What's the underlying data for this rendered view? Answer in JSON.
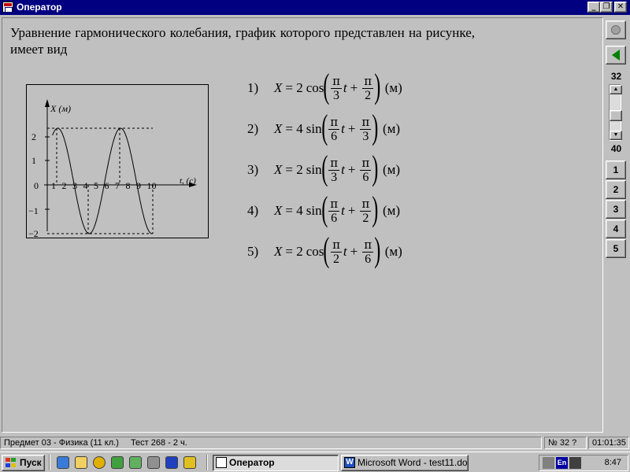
{
  "window": {
    "title": "Оператор"
  },
  "question": {
    "text": "Уравнение гармонического колебания, график которого представлен на рисунке, имеет вид"
  },
  "graph": {
    "y_label": "X (м)",
    "x_label": "t, (c)",
    "origin_label": "0",
    "x_ticks": [
      "1",
      "2",
      "3",
      "4",
      "5",
      "6",
      "7",
      "8",
      "9",
      "10"
    ],
    "y_ticks": [
      "2",
      "1",
      "−1",
      "−2"
    ]
  },
  "answers": [
    {
      "num": "1)",
      "lhs": "X",
      "coef": "= 2",
      "func": "cos",
      "num1": "π",
      "den1": "3",
      "t": "t",
      "plus": "+",
      "num2": "π",
      "den2": "2",
      "unit": "(м)"
    },
    {
      "num": "2)",
      "lhs": "X",
      "coef": "= 4",
      "func": "sin",
      "num1": "π",
      "den1": "6",
      "t": "t",
      "plus": "+",
      "num2": "π",
      "den2": "3",
      "unit": "(м)"
    },
    {
      "num": "3)",
      "lhs": "X",
      "coef": "= 2",
      "func": "sin",
      "num1": "π",
      "den1": "3",
      "t": "t",
      "plus": "+",
      "num2": "π",
      "den2": "6",
      "unit": "(м)"
    },
    {
      "num": "4)",
      "lhs": "X",
      "coef": "= 4",
      "func": "sin",
      "num1": "π",
      "den1": "6",
      "t": "t",
      "plus": "+",
      "num2": "π",
      "den2": "2",
      "unit": "(м)"
    },
    {
      "num": "5)",
      "lhs": "X",
      "coef": "= 2",
      "func": "cos",
      "num1": "π",
      "den1": "2",
      "t": "t",
      "plus": "+",
      "num2": "π",
      "den2": "6",
      "unit": "(м)"
    }
  ],
  "side": {
    "current": "32",
    "total": "40",
    "scroll_position": 0.6,
    "answer_buttons": [
      "1",
      "2",
      "3",
      "4",
      "5"
    ]
  },
  "status": {
    "subject": "Предмет 03 - Физика (11 кл.)",
    "test": "Тест 268 - 2 ч.",
    "question_no": "№ 32 ?",
    "timer": "01:01:35"
  },
  "taskbar": {
    "start_label": "Пуск",
    "tasks": [
      {
        "label": "Оператор",
        "active": true
      },
      {
        "label": "Microsoft Word - test11.doc",
        "active": false
      }
    ],
    "tray_lang": "En",
    "clock": "8:47"
  }
}
